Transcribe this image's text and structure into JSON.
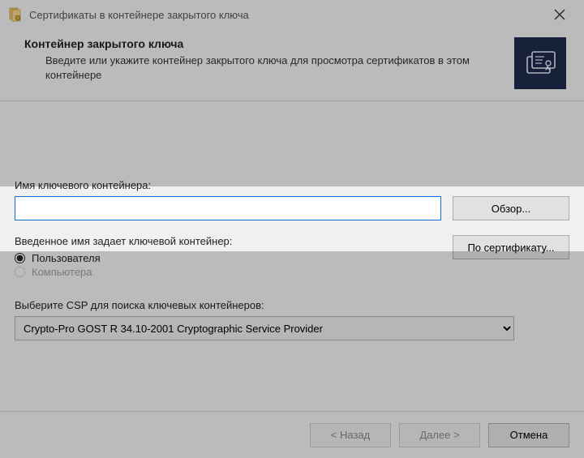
{
  "window": {
    "title": "Сертификаты в контейнере закрытого ключа"
  },
  "header": {
    "title": "Контейнер закрытого ключа",
    "desc": "Введите или укажите контейнер закрытого ключа для просмотра сертификатов в этом контейнере"
  },
  "container_name": {
    "label": "Имя ключевого контейнера:",
    "value": "",
    "browse_btn": "Обзор..."
  },
  "scope": {
    "heading": "Введенное имя задает ключевой контейнер:",
    "user_label": "Пользователя",
    "computer_label": "Компьютера",
    "by_cert_btn": "По сертификату..."
  },
  "csp": {
    "label": "Выберите CSP для поиска ключевых контейнеров:",
    "selected": "Crypto-Pro GOST R 34.10-2001 Cryptographic Service Provider"
  },
  "footer": {
    "back": "< Назад",
    "next": "Далее >",
    "cancel": "Отмена"
  }
}
